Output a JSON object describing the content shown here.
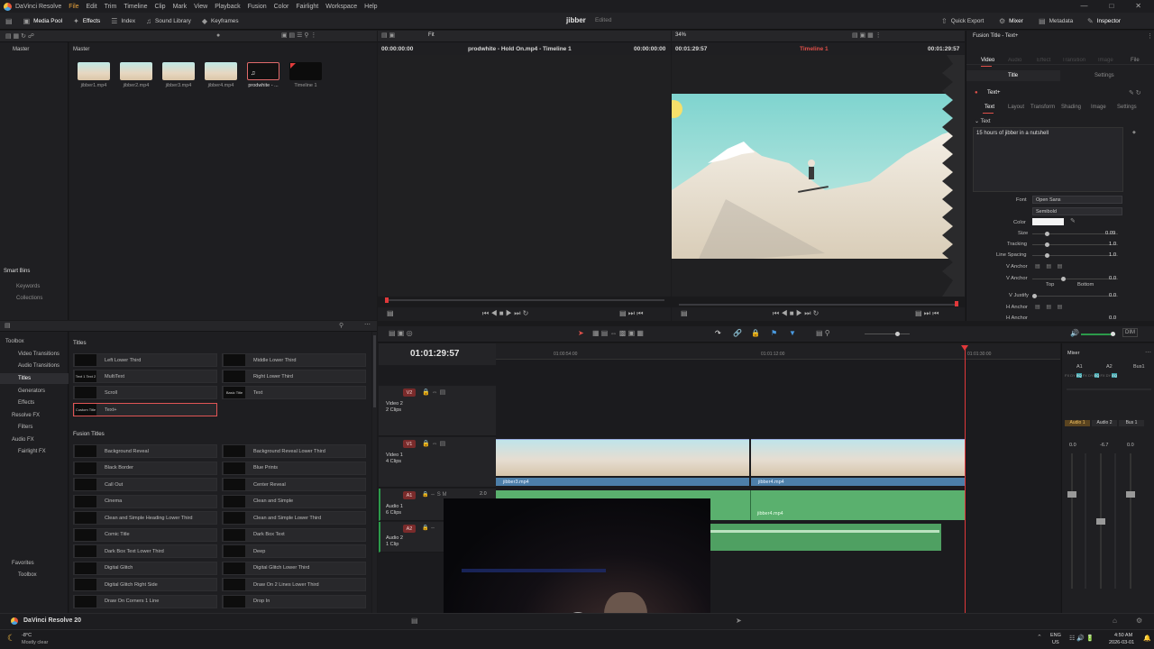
{
  "app": {
    "title": "DaVinci Resolve",
    "project": "jibber",
    "status": "Edited"
  },
  "menu": [
    "File",
    "Edit",
    "Trim",
    "Timeline",
    "Clip",
    "Mark",
    "View",
    "Playback",
    "Fusion",
    "Color",
    "Fairlight",
    "Workspace",
    "Help"
  ],
  "toolbar": {
    "media_pool": "Media Pool",
    "effects": "Effects",
    "index": "Index",
    "sound_library": "Sound Library",
    "keyframes": "Keyframes",
    "quick_export": "Quick Export",
    "mixer": "Mixer",
    "metadata": "Metadata",
    "inspector": "Inspector"
  },
  "media_pool": {
    "tab": "Master",
    "bin_title": "Master",
    "clips": [
      {
        "name": "jibber1.mp4"
      },
      {
        "name": "jibber2.mp4"
      },
      {
        "name": "jibber3.mp4"
      },
      {
        "name": "jibber4.mp4"
      },
      {
        "name": "prodwhite - ..."
      },
      {
        "name": "Timeline 1"
      }
    ],
    "smart_bins": "Smart Bins",
    "keywords": "Keywords",
    "collections": "Collections"
  },
  "effects": {
    "tree": {
      "toolbox": "Toolbox",
      "video_transitions": "Video Transitions",
      "audio_transitions": "Audio Transitions",
      "titles": "Titles",
      "generators": "Generators",
      "effects": "Effects",
      "resolve_fx": "Resolve FX",
      "filters": "Filters",
      "audio_fx": "Audio FX",
      "fairlight_fx": "Fairlight FX",
      "favorites": "Favorites",
      "toolbox2": "Toolbox"
    },
    "titles_header": "Titles",
    "titles": [
      {
        "name": "Left Lower Third",
        "icon": ""
      },
      {
        "name": "Middle Lower Third",
        "icon": ""
      },
      {
        "name": "MultiText",
        "icon": "Text 1 Text 2"
      },
      {
        "name": "Right Lower Third",
        "icon": ""
      },
      {
        "name": "Scroll",
        "icon": ""
      },
      {
        "name": "Text",
        "icon": "Basic Title"
      },
      {
        "name": "Text+",
        "icon": "Custom Title"
      }
    ],
    "fusion_header": "Fusion Titles",
    "fusion": [
      "Background Reveal",
      "Background Reveal Lower Third",
      "Black Border",
      "Blue Prints",
      "Call Out",
      "Center Reveal",
      "Cinema",
      "Clean and Simple",
      "Clean and Simple Heading Lower Third",
      "Clean and Simple Lower Third",
      "Comic Title",
      "Dark Box Text",
      "Dark Box Text Lower Third",
      "Deep",
      "Digital Glitch",
      "Digital Glitch Lower Third",
      "Digital Glitch Right Side",
      "Draw On 2 Lines Lower Third",
      "Draw On Corners 1 Line",
      "Drop In"
    ]
  },
  "source_viewer": {
    "zoom": "Fit",
    "tc_left": "00:00:00:00",
    "clip": "prodwhite - Hold On.mp4 - Timeline 1",
    "tc_right": "00:00:00:00"
  },
  "program_viewer": {
    "zoom": "34%",
    "tc_left": "00:01:29:57",
    "timeline": "Timeline 1",
    "tc_right": "00:01:29:57"
  },
  "timeline": {
    "timecode": "01:01:29:57",
    "ruler": [
      "01:00:54:00",
      "01:01:12:00",
      "01:01:30:00"
    ],
    "tracks": {
      "v2": {
        "badge": "V2",
        "name": "Video 2",
        "clips": "2 Clips"
      },
      "v1": {
        "badge": "V1",
        "name": "Video 1",
        "clips": "4 Clips"
      },
      "a1": {
        "badge": "A1",
        "name": "Audio 1",
        "clips": "6 Clips",
        "level": "2.0"
      },
      "a2": {
        "badge": "A2",
        "name": "Audio 2",
        "clips": "1 Clip"
      }
    },
    "clip_labels": {
      "v1a": "jibber3.mp4",
      "v1b": "jibber4.mp4",
      "a1b": "jibber4.mp4"
    }
  },
  "inspector": {
    "title": "Fusion Title - Text+",
    "tabs": [
      "Video",
      "Audio",
      "Effect",
      "Transition",
      "Image",
      "File"
    ],
    "subtabs": [
      "Title",
      "Settings"
    ],
    "node": "Text+",
    "node_tabs": [
      "Text",
      "Layout",
      "Transform",
      "Shading",
      "Image",
      "Settings"
    ],
    "section": "Text",
    "text_value": "15 hours of jibber in a nutshell",
    "font_label": "Font",
    "font": "Open Sans",
    "weight": "Semibold",
    "color_label": "Color",
    "size_label": "Size",
    "size": "0.09",
    "tracking_label": "Tracking",
    "tracking": "1.0",
    "line_spacing_label": "Line Spacing",
    "line_spacing": "1.0",
    "v_anchor_label": "V Anchor",
    "v_anchor2_label": "V Anchor",
    "v_anchor": "0.0",
    "top": "Top",
    "bottom": "Bottom",
    "v_justify_label": "V Justify",
    "v_justify": "0.0",
    "h_anchor_label": "H Anchor",
    "h_anchor2_label": "H Anchor",
    "h_anchor": "0.0"
  },
  "mixer": {
    "title": "Mixer",
    "channels": [
      "A1",
      "A2",
      "Bus1"
    ],
    "labels": [
      "Audio 1",
      "Audio 2",
      "Bus 1"
    ],
    "values": [
      "0.0",
      "-6.7",
      "0.0"
    ],
    "dim": "DIM"
  },
  "taskbar": {
    "app_label": "DaVinci Resolve 20",
    "weather_temp": "-8°C",
    "weather": "Mostly clear",
    "lang": "ENG",
    "region": "US",
    "time": "4:50 AM",
    "date": "2026-03-01"
  }
}
